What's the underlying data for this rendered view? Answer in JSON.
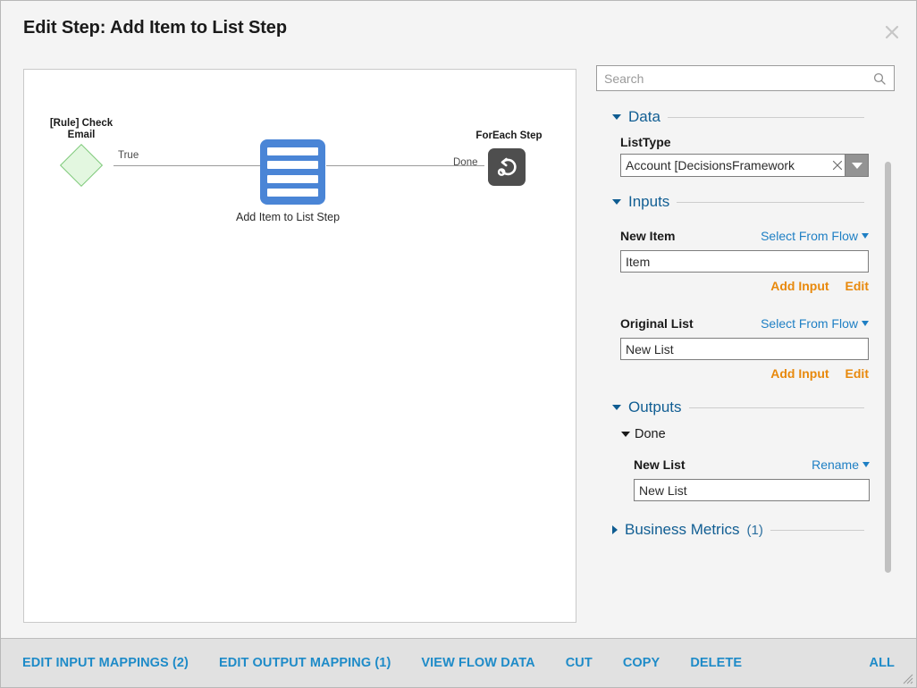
{
  "dialog": {
    "title": "Edit Step: Add Item to List Step",
    "close_icon": "close-icon"
  },
  "canvas": {
    "nodes": [
      {
        "id": "rule",
        "label": "[Rule] Check\nEmail",
        "shape": "diamond"
      },
      {
        "id": "add-item",
        "caption": "Add Item to List Step",
        "shape": "list-icon"
      },
      {
        "id": "foreach",
        "label": "ForEach Step",
        "shape": "loop-icon"
      }
    ],
    "edges": [
      {
        "label": "True",
        "from": "rule",
        "to": "add-item"
      },
      {
        "label": "Done",
        "from": "add-item",
        "to": "foreach"
      }
    ]
  },
  "search": {
    "placeholder": "Search",
    "value": "",
    "icon": "search-icon"
  },
  "sections": {
    "data": {
      "title": "Data",
      "expanded": true,
      "list_type": {
        "label": "ListType",
        "value": "Account  [DecisionsFramework",
        "clear_icon": "clear-x-icon",
        "dropdown_icon": "chevron-down-icon"
      }
    },
    "inputs": {
      "title": "Inputs",
      "expanded": true,
      "fields": [
        {
          "label": "New Item",
          "source_label": "Select From Flow",
          "value": "Item",
          "add_input_label": "Add Input",
          "edit_label": "Edit"
        },
        {
          "label": "Original List",
          "source_label": "Select From Flow",
          "value": "New List",
          "add_input_label": "Add Input",
          "edit_label": "Edit"
        }
      ]
    },
    "outputs": {
      "title": "Outputs",
      "expanded": true,
      "group": {
        "label": "Done",
        "expanded": true,
        "field": {
          "label": "New List",
          "action_label": "Rename",
          "value": "New List"
        }
      }
    },
    "business_metrics": {
      "title": "Business Metrics",
      "count": "(1)",
      "expanded": false
    }
  },
  "footer": {
    "links": [
      "EDIT INPUT MAPPINGS (2)",
      "EDIT OUTPUT MAPPING (1)",
      "VIEW FLOW DATA",
      "CUT",
      "COPY",
      "DELETE"
    ],
    "all_label": "ALL"
  },
  "colors": {
    "accent_blue": "#1e8bc8",
    "link_blue": "#1e7fc4",
    "section_blue": "#115e93",
    "orange": "#e8890c",
    "node_blue": "#4a85d6",
    "node_green_fill": "#e3f7e0",
    "node_green_border": "#7ec97a",
    "node_dark": "#4e4e4e",
    "dialog_bg": "#f4f4f4",
    "footer_bg": "#e1e1e1"
  }
}
